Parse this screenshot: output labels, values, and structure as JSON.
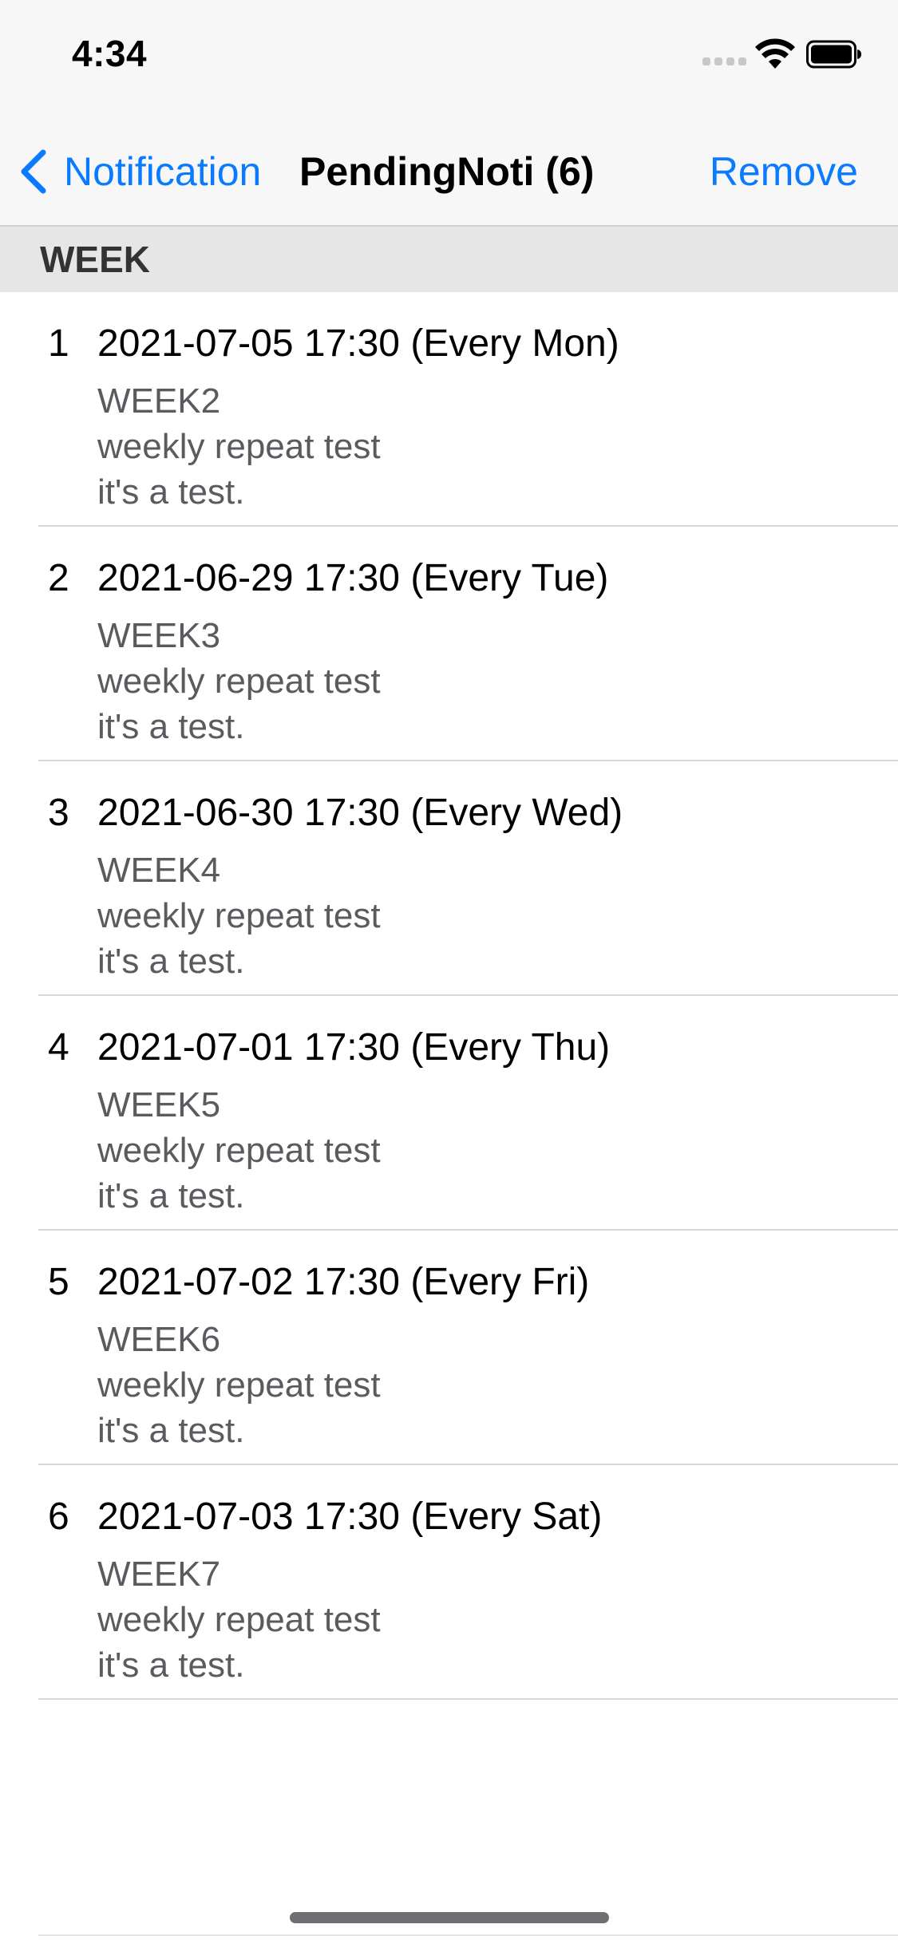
{
  "status_bar": {
    "time": "4:34",
    "icons": [
      "cellular-signal-icon",
      "wifi-icon",
      "battery-icon"
    ]
  },
  "nav": {
    "back_label": "Notification",
    "title": "PendingNoti (6)",
    "right_label": "Remove",
    "accent": "#0a7aff"
  },
  "section": {
    "header": "WEEK"
  },
  "items": [
    {
      "index": "1",
      "title": "2021-07-05 17:30 (Every Mon)",
      "identifier": "WEEK2",
      "subtitle": "weekly repeat test",
      "body": "it's a test."
    },
    {
      "index": "2",
      "title": "2021-06-29 17:30 (Every Tue)",
      "identifier": "WEEK3",
      "subtitle": "weekly repeat test",
      "body": "it's a test."
    },
    {
      "index": "3",
      "title": "2021-06-30 17:30 (Every Wed)",
      "identifier": "WEEK4",
      "subtitle": "weekly repeat test",
      "body": "it's a test."
    },
    {
      "index": "4",
      "title": "2021-07-01 17:30 (Every Thu)",
      "identifier": "WEEK5",
      "subtitle": "weekly repeat test",
      "body": "it's a test."
    },
    {
      "index": "5",
      "title": "2021-07-02 17:30 (Every Fri)",
      "identifier": "WEEK6",
      "subtitle": "weekly repeat test",
      "body": "it's a test."
    },
    {
      "index": "6",
      "title": "2021-07-03 17:30 (Every Sat)",
      "identifier": "WEEK7",
      "subtitle": "weekly repeat test",
      "body": "it's a test."
    }
  ]
}
